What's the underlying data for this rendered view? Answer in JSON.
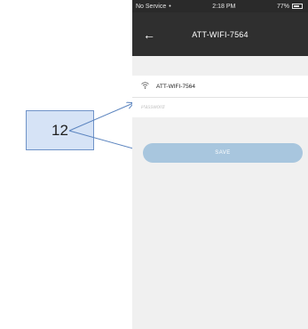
{
  "callout": {
    "label": "12"
  },
  "statusbar": {
    "carrier": "No Service",
    "time": "2:18 PM",
    "battery": "77%"
  },
  "navbar": {
    "title": "ATT-WIFI-7564",
    "back_icon": "arrow-left-icon"
  },
  "network": {
    "name": "ATT-WIFI-7564",
    "icon": "wifi-icon"
  },
  "password": {
    "value": "",
    "placeholder": "Password"
  },
  "save_button": {
    "label": "SAVE"
  },
  "colors": {
    "navbar": "#2f2f2f",
    "save_button": "#a8c6de",
    "callout_fill": "#d6e3f6",
    "callout_border": "#6f93c8",
    "arrow": "#5b84bf"
  }
}
